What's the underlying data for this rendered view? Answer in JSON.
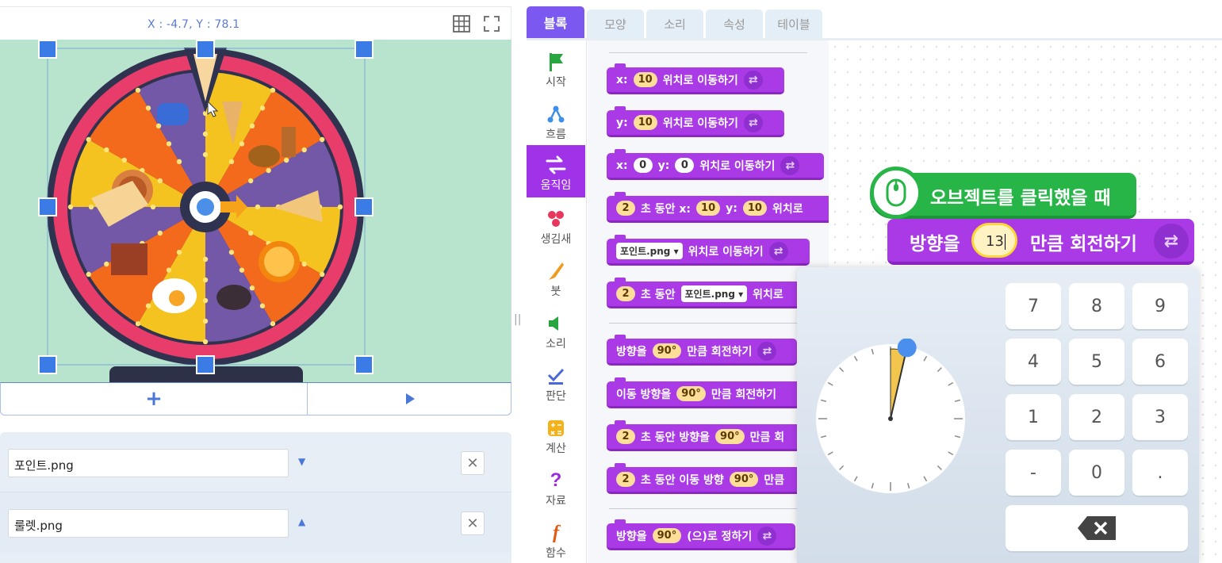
{
  "stage": {
    "coords": "X : -4.7, Y : 78.1",
    "add_label": "+",
    "objects": [
      {
        "name": "포인트.png",
        "arrow": "▼"
      },
      {
        "name": "룰렛.png",
        "arrow": "▲"
      }
    ]
  },
  "tabs": [
    "블록",
    "모양",
    "소리",
    "속성",
    "테이블"
  ],
  "categories": [
    "시작",
    "흐름",
    "움직임",
    "생김새",
    "붓",
    "소리",
    "판단",
    "계산",
    "자료",
    "함수"
  ],
  "palette": {
    "b1": {
      "a": "x:",
      "v": "10",
      "b": "위치로 이동하기"
    },
    "b2": {
      "a": "y:",
      "v": "10",
      "b": "위치로 이동하기"
    },
    "b3": {
      "a": "x:",
      "v1": "0",
      "m": "y:",
      "v2": "0",
      "b": "위치로 이동하기"
    },
    "b4": {
      "v": "2",
      "a": "초 동안 x:",
      "v1": "10",
      "m": "y:",
      "v2": "10",
      "b": "위치로"
    },
    "b5": {
      "dd": "포인트.png ▾",
      "b": "위치로 이동하기"
    },
    "b6": {
      "v": "2",
      "a": "초 동안",
      "dd": "포인트.png ▾",
      "b": "위치로"
    },
    "b7": {
      "a": "방향을",
      "v": "90°",
      "b": "만큼 회전하기"
    },
    "b8": {
      "a": "이동 방향을",
      "v": "90°",
      "b": "만큼 회전하기"
    },
    "b9": {
      "v": "2",
      "a": "초 동안 방향을",
      "v2": "90°",
      "b": "만큼 회"
    },
    "b10": {
      "v": "2",
      "a": "초 동안 이동 방향",
      "v2": "90°",
      "b": "만큼"
    },
    "b11": {
      "a": "방향을",
      "v": "90°",
      "b": "(으)로 정하기"
    }
  },
  "script": {
    "event_label": "오브젝트를 클릭했을 때",
    "turn_prefix": "방향을",
    "turn_value": "13",
    "turn_suffix": "만큼 회전하기"
  },
  "keypad": [
    "7",
    "8",
    "9",
    "4",
    "5",
    "6",
    "1",
    "2",
    "3",
    "-",
    "0",
    "."
  ],
  "dial": {
    "angle_deg": 13
  },
  "colors": {
    "motion": "#a93ae5",
    "event": "#27b547",
    "tab_active": "#7b59f0"
  }
}
